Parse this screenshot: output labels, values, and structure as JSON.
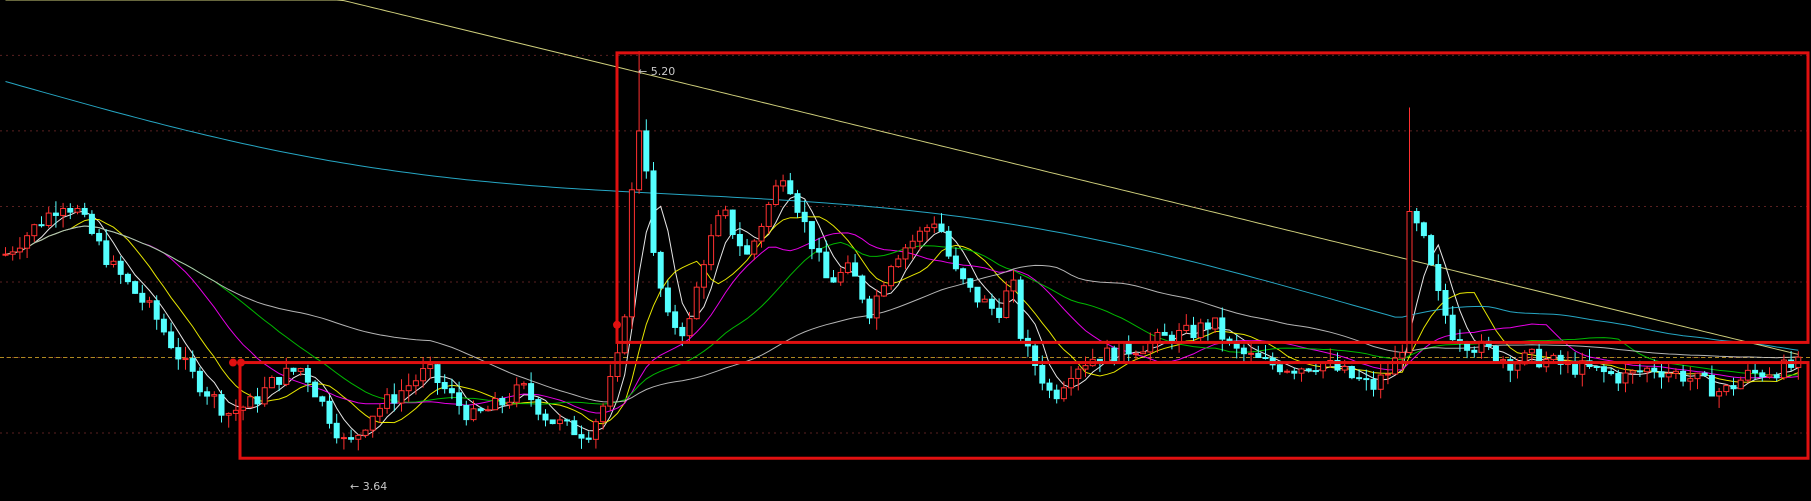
{
  "chart_data": {
    "type": "candlestick",
    "title": "",
    "xlabel": "",
    "ylabel": "",
    "ylim": [
      3.45,
      5.42
    ],
    "grid": "dotted-horizontal",
    "legend": "none",
    "reference_price": 4.0,
    "annotations": [
      {
        "label": "← 5.20",
        "value": 5.2,
        "kind": "high"
      },
      {
        "label": "← 3.64",
        "value": 3.64,
        "kind": "low"
      }
    ],
    "highlight_boxes": [
      {
        "name": "upper-zone",
        "price_top": 5.21,
        "price_bottom": 4.06
      },
      {
        "name": "lower-zone",
        "price_top": 3.98,
        "price_bottom": 3.6
      }
    ],
    "series": [
      {
        "name": "",
        "color": "#ffffff"
      },
      {
        "name": "",
        "color": "#ffff00"
      },
      {
        "name": "",
        "color": "#ff00ff"
      },
      {
        "name": "",
        "color": "#00cc00"
      },
      {
        "name": "",
        "color": "#c8c8c8"
      },
      {
        "name": "",
        "color": "#2ab8d8"
      },
      {
        "name": "",
        "color": "#e6e68a"
      }
    ],
    "colors": {
      "up": "#ff3030",
      "down": "#54ffff",
      "box": "#e01010",
      "grid": "#5a2020",
      "reference": "#b08a20",
      "label": "#c8c8c8"
    }
  }
}
